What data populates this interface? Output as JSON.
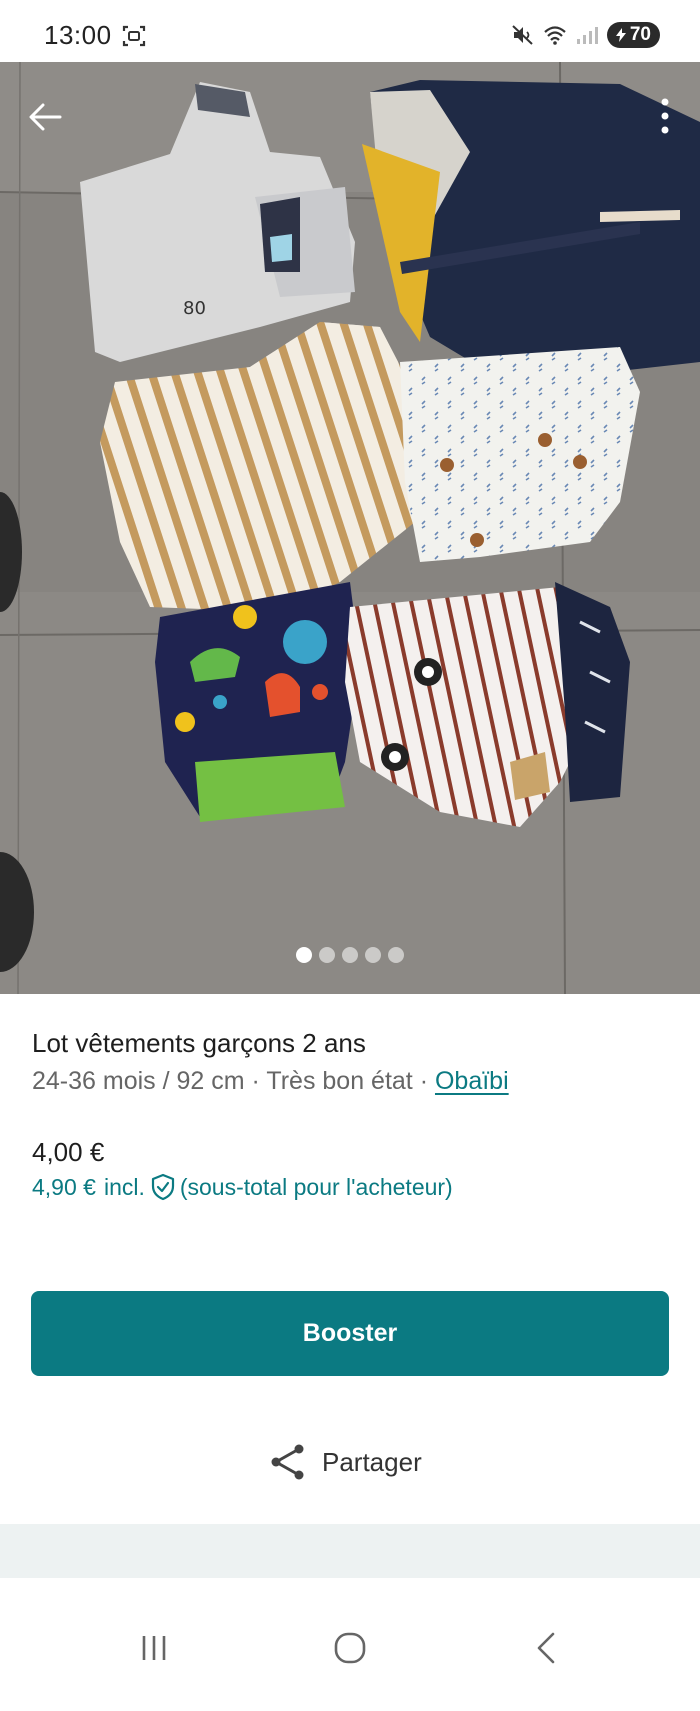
{
  "status_bar": {
    "time": "13:00",
    "battery": "70",
    "icons": [
      "screenshot-icon",
      "mute-icon",
      "wifi-icon",
      "signal-icon",
      "battery-icon"
    ]
  },
  "photo": {
    "slide_count": 5,
    "active_slide": 1
  },
  "listing": {
    "title": "Lot vêtements garçons 2 ans",
    "size": "24-36 mois / 92 cm",
    "separator": "·",
    "condition": "Très bon état",
    "brand": "Obaïbi",
    "price": "4,00 €",
    "price_incl": "4,90 €",
    "incl_label": "incl.",
    "buyer_note": "(sous-total pour l'acheteur)"
  },
  "actions": {
    "booster_label": "Booster",
    "share_label": "Partager"
  },
  "colors": {
    "accent": "#0b7a82",
    "band": "#edf2f2"
  }
}
